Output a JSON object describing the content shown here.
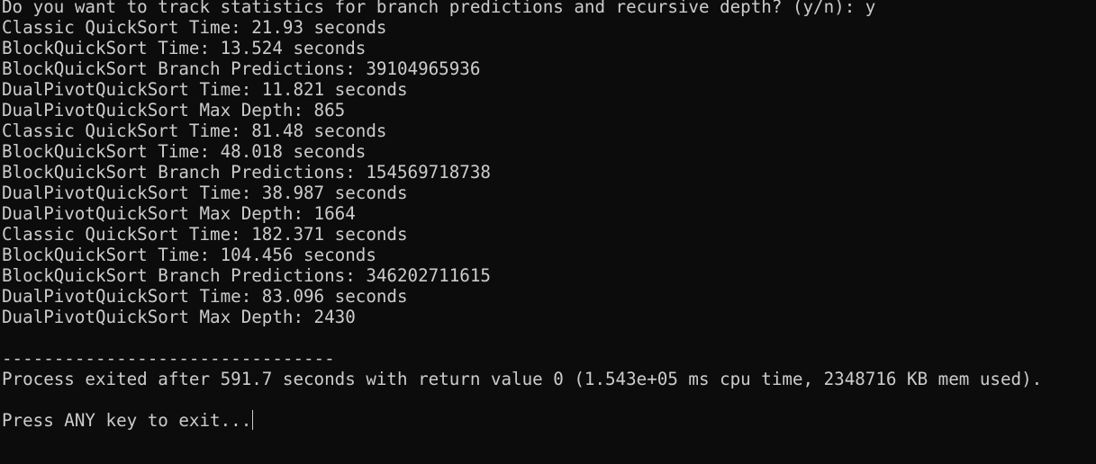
{
  "console": {
    "lines": [
      "Do you want to track statistics for branch predictions and recursive depth? (y/n): y",
      "Classic QuickSort Time: 21.93 seconds",
      "BlockQuickSort Time: 13.524 seconds",
      "BlockQuickSort Branch Predictions: 39104965936",
      "DualPivotQuickSort Time: 11.821 seconds",
      "DualPivotQuickSort Max Depth: 865",
      "Classic QuickSort Time: 81.48 seconds",
      "BlockQuickSort Time: 48.018 seconds",
      "BlockQuickSort Branch Predictions: 154569718738",
      "DualPivotQuickSort Time: 38.987 seconds",
      "DualPivotQuickSort Max Depth: 1664",
      "Classic QuickSort Time: 182.371 seconds",
      "BlockQuickSort Time: 104.456 seconds",
      "BlockQuickSort Branch Predictions: 346202711615",
      "DualPivotQuickSort Time: 83.096 seconds",
      "DualPivotQuickSort Max Depth: 2430"
    ],
    "separator": "--------------------------------",
    "exit_message": "Process exited after 591.7 seconds with return value 0 (1.543e+05 ms cpu time, 2348716 KB mem used).",
    "press_key_prompt": "Press ANY key to exit..."
  },
  "colors": {
    "background": "#0c0c0c",
    "foreground": "#cccccc"
  }
}
